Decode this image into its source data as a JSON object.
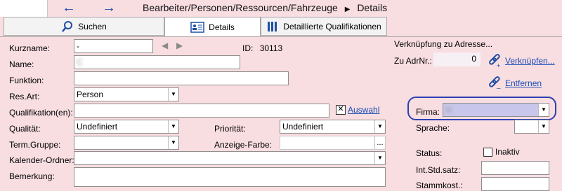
{
  "breadcrumb": "Bearbeiter/Personen/Ressourcen/Fahrzeuge",
  "breadcrumb_current": "Details",
  "tabs": [
    {
      "label": "Suchen"
    },
    {
      "label": "Details"
    },
    {
      "label": "Detaillierte Qualifikationen"
    }
  ],
  "form": {
    "kurzname_label": "Kurzname:",
    "kurzname_value": "-",
    "id_label": "ID:",
    "id_value": "30113",
    "name_label": "Name:",
    "name_value": "C",
    "funktion_label": "Funktion:",
    "funktion_value": "",
    "resart_label": "Res.Art:",
    "resart_value": "Person",
    "qualifikation_label": "Qualifikation(en):",
    "qualifikation_value": "",
    "auswahl_label": "Auswahl",
    "qualitaet_label": "Qualität:",
    "qualitaet_value": "Undefiniert",
    "prioritaet_label": "Priorität:",
    "prioritaet_value": "Undefiniert",
    "termgruppe_label": "Term.Gruppe:",
    "termgruppe_value": "",
    "anzeigefarbe_label": "Anzeige-Farbe:",
    "anzeigefarbe_btn": "...",
    "kalender_label": "Kalender-Ordner:",
    "kalender_value": "",
    "bemerkung_label": "Bemerkung:"
  },
  "right": {
    "verknuepfung_title": "Verknüpfung zu Adresse...",
    "zuadr_label": "Zu AdrNr.:",
    "zuadr_value": "0",
    "verknuepfen_link": "Verknüpfen...",
    "entfernen_link": "Entfernen",
    "firma_label": "Firma:",
    "firma_value": "N",
    "sprache_label": "Sprache:",
    "sprache_value": "",
    "status_label": "Status:",
    "inaktiv_label": "Inaktiv",
    "intstd_label": "Int.Std.satz:",
    "intstd_value": "",
    "stammkost_label": "Stammkost.:",
    "stammkost_value": ""
  },
  "colors": {
    "background": "#f8dde1",
    "highlight_ring": "#2e3fb2",
    "firma_field": "#c9c6eb",
    "link": "#1a4fb5"
  }
}
